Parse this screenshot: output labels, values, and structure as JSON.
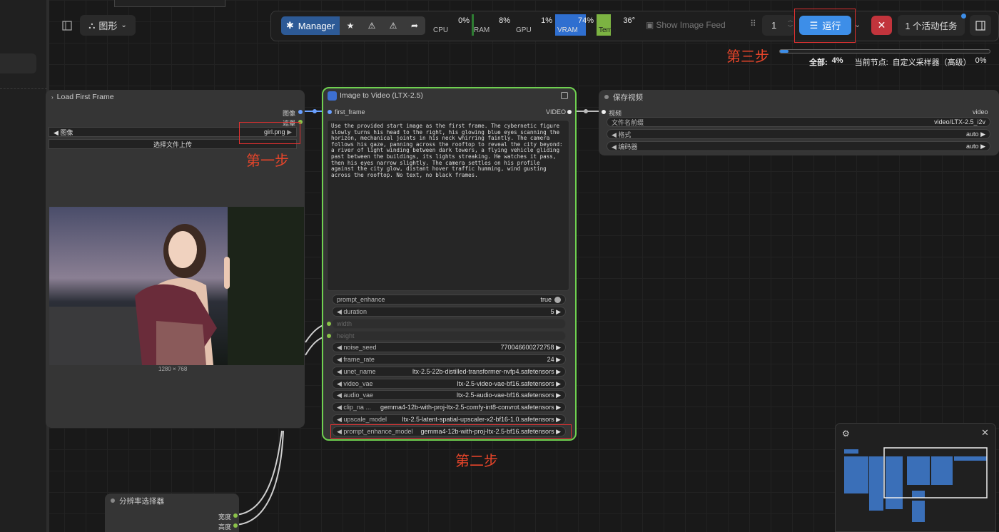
{
  "app": {
    "graph_menu": "图形"
  },
  "toolbar": {
    "manager": "Manager",
    "cpu": {
      "label": "CPU",
      "value": "0%"
    },
    "ram": {
      "label": "RAM",
      "value": "8%"
    },
    "gpu": {
      "label": "GPU",
      "value": "1%"
    },
    "vram": {
      "label": "VRAM",
      "value": "74%"
    },
    "temp": {
      "label": "Temp",
      "value": "36°"
    },
    "image_feed": "Show Image Feed",
    "queue_count": "1",
    "run": "运行",
    "active_tasks": "1 个活动任务"
  },
  "progress": {
    "total_label": "全部:",
    "total_value": "4%",
    "current_label": "当前节点:",
    "current_node": "自定义采样器（高级）",
    "current_value": "0%",
    "fraction": 0.04
  },
  "load_node": {
    "title": "Load First Frame",
    "out_image": "图像",
    "out_mask": "遮罩",
    "image_widget_label": "图像",
    "image_widget_value": "girl.png",
    "upload": "选择文件上传",
    "dims": "1280 × 768"
  },
  "i2v_node": {
    "title": "Image to Video (LTX-2.5)",
    "in": "first_frame",
    "out": "VIDEO",
    "prompt": "Use the provided start image as the first frame. The cybernetic figure slowly turns his head to the right, his glowing blue eyes scanning the horizon, mechanical joints in his neck whirring faintly. The camera follows his gaze, panning across the rooftop to reveal the city beyond: a river of light winding between dark towers, a flying vehicle gliding past between the buildings, its lights streaking. He watches it pass, then his eyes narrow slightly. The camera settles on his profile against the city glow, distant hover traffic humming, wind gusting across the rooftop. No text, no black frames.",
    "widgets": [
      {
        "k": "prompt_enhance",
        "v": "true"
      },
      {
        "k": "duration",
        "v": "5"
      },
      {
        "k": "width",
        "v": ""
      },
      {
        "k": "height",
        "v": ""
      },
      {
        "k": "noise_seed",
        "v": "770046600272758"
      },
      {
        "k": "frame_rate",
        "v": "24"
      },
      {
        "k": "unet_name",
        "v": "ltx-2.5-22b-distilled-transformer-nvfp4.safetensors"
      },
      {
        "k": "video_vae",
        "v": "ltx-2.5-video-vae-bf16.safetensors"
      },
      {
        "k": "audio_vae",
        "v": "ltx-2.5-audio-vae-bf16.safetensors"
      },
      {
        "k": "clip_na ...",
        "v": "gemma4-12b-with-proj-ltx-2.5-comfy-int8-convrot.safetensors"
      },
      {
        "k": "upscale_model",
        "v": "ltx-2.5-latent-spatial-upscaler-x2-bf16-1.0.safetensors"
      },
      {
        "k": "prompt_enhance_model",
        "v": "gemma4-12b-with-proj-ltx-2.5-bf16.safetensors"
      }
    ]
  },
  "save_node": {
    "title": "保存视频",
    "in": "视频",
    "out": "video",
    "prefix_label": "文件名前缀",
    "prefix_value": "video/LTX-2.5_i2v",
    "format_label": "格式",
    "format_value": "auto",
    "codec_label": "编码器",
    "codec_value": "auto"
  },
  "res_node": {
    "title": "分辨率选择器",
    "width": "宽度",
    "height": "高度"
  },
  "steps": {
    "one": "第一步",
    "two": "第二步",
    "three": "第三步"
  },
  "colors": {
    "accent": "#3d8ee8",
    "node_green": "#6fd050",
    "step_red": "#e8452a"
  }
}
